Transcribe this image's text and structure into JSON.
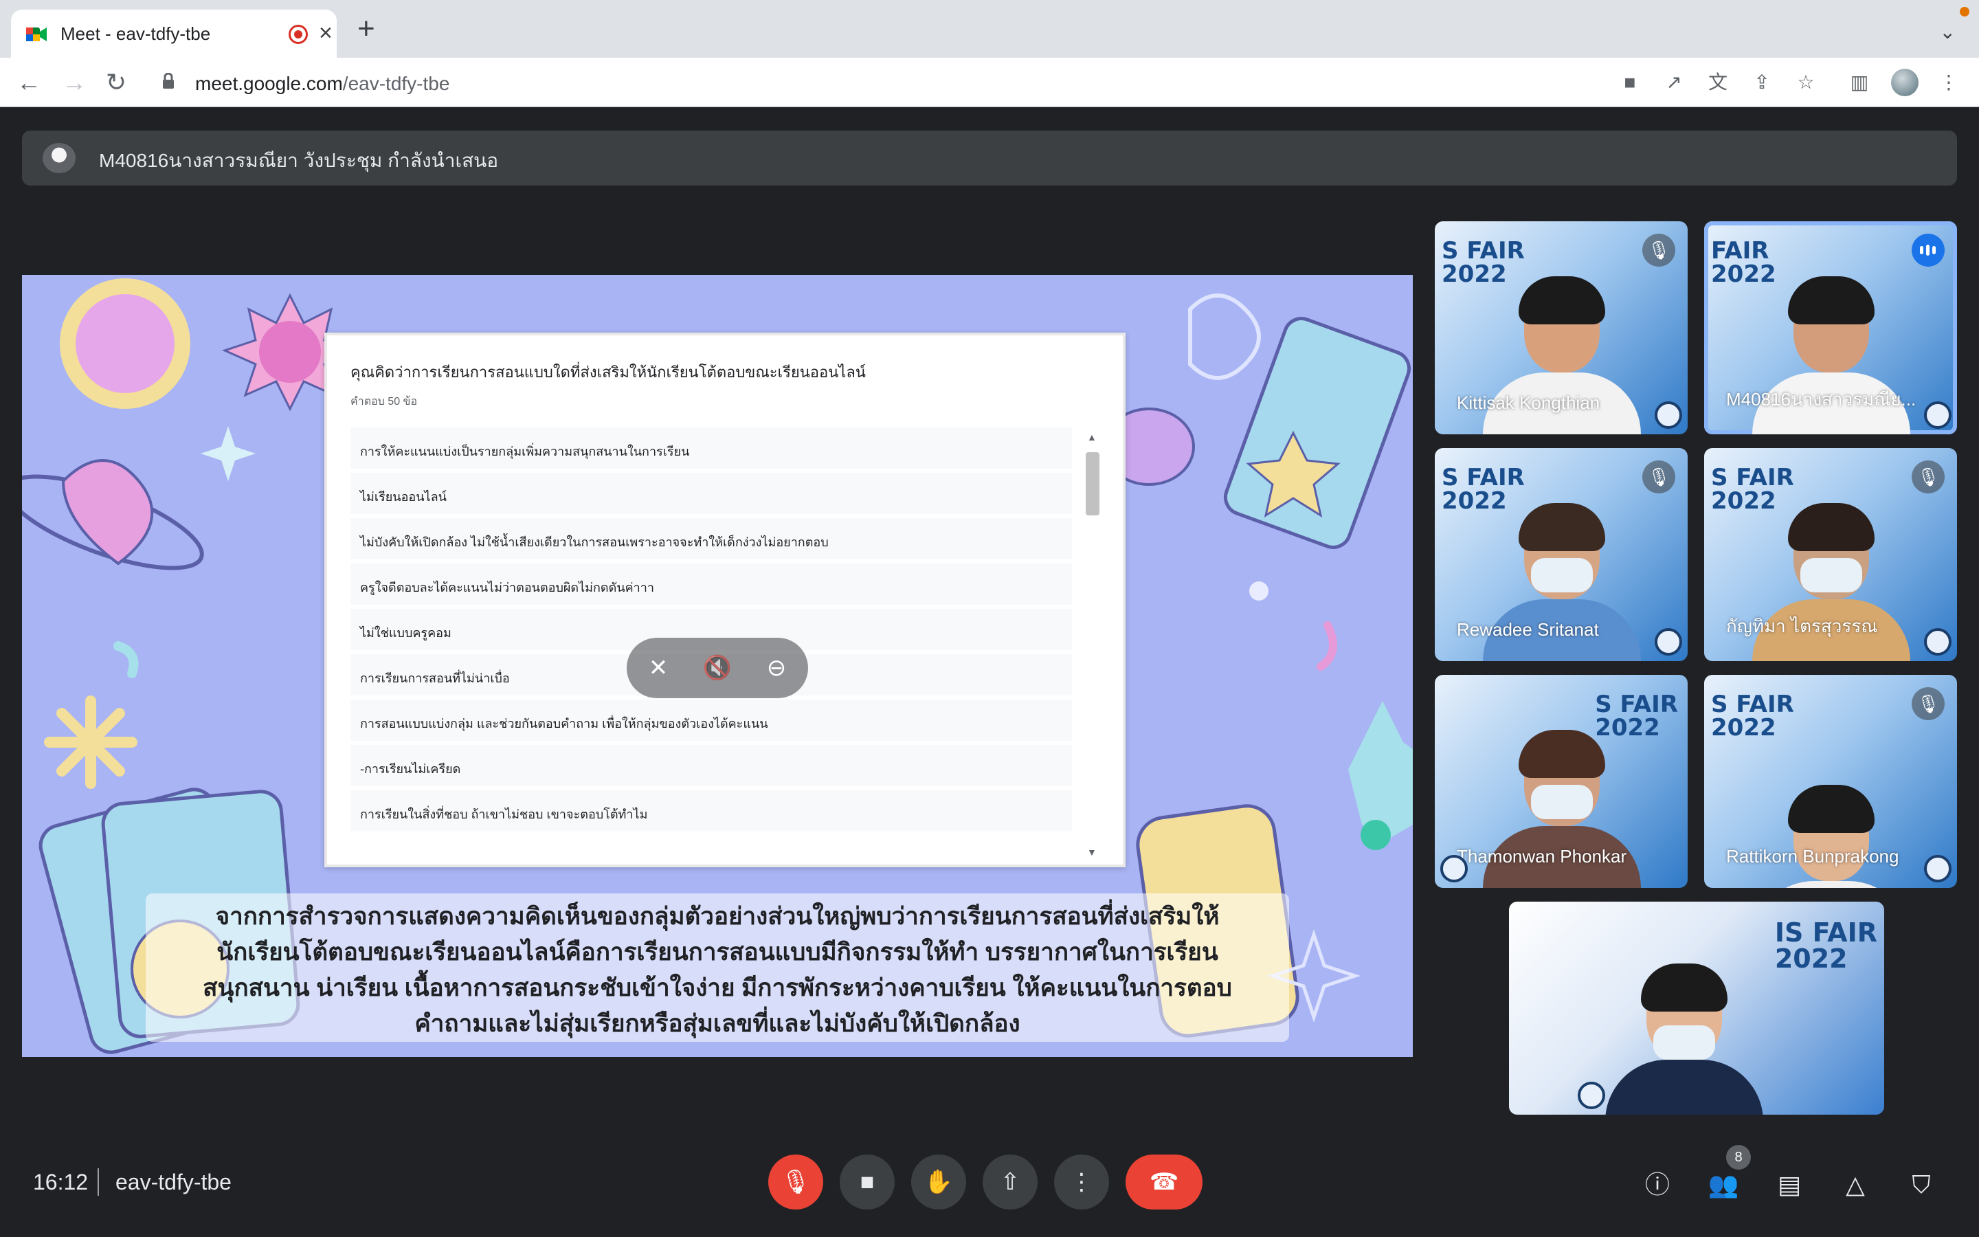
{
  "browser": {
    "tab_title": "Meet - eav-tdfy-tbe",
    "url_host": "meet.google.com",
    "url_path": "/eav-tdfy-tbe"
  },
  "presenter_bar": {
    "text": "M40816นางสาวรมณียา วังประชุม กำลังนำเสนอ"
  },
  "form": {
    "question": "คุณคิดว่าการเรียนการสอนแบบใดที่ส่งเสริมให้นักเรียนโต้ตอบขณะเรียนออนไลน์",
    "response_count": "คำตอบ 50 ข้อ",
    "answers": [
      "การให้คะแนนแบ่งเป็นรายกลุ่มเพิ่มความสนุกสนานในการเรียน",
      "ไม่เรียนออนไลน์",
      "ไม่บังคับให้เปิดกล้อง ไม่ใช้น้ำเสียงเดียวในการสอนเพราะอาจจะทำให้เด็กง่วงไม่อยากตอบ",
      "ครูใจดีตอบละได้คะแนนไม่ว่าตอนตอบผิดไม่กดดันค่าาา",
      "ไม่ใช่แบบครูคอม",
      "การเรียนการสอนที่ไม่น่าเบื่อ",
      "การสอนแบบแบ่งกลุ่ม และช่วยกันตอบคำถาม เพื่อให้กลุ่มของตัวเองได้คะแนน",
      "-การเรียนไม่เครียด",
      "การเรียนในสิ่งที่ชอบ ถ้าเขาไม่ชอบ เขาจะตอบโต้ทำไม"
    ]
  },
  "caption": {
    "lines": [
      "จากการสำรวจการแสดงความคิดเห็นของกลุ่มตัวอย่างส่วนใหญ่พบว่าการเรียนการสอนที่ส่งเสริมให้",
      "นักเรียนโต้ตอบขณะเรียนออนไลน์คือการเรียนการสอนแบบมีกิจกรรมให้ทำ บรรยากาศในการเรียน",
      "สนุกสนาน น่าเรียน เนื้อหาการสอนกระชับเข้าใจง่าย มีการพักระหว่างคาบเรียน ให้คะแนนในการตอบ",
      "คำถามและไม่สุ่มเรียกหรือสุ่มเลขที่และไม่บังคับให้เปิดกล้อง"
    ]
  },
  "participants": [
    {
      "name": "Kittisak Kongthian",
      "state": "muted",
      "fair": "S FAIR\n2022"
    },
    {
      "name": "M40816นางสาวรมณีย...",
      "state": "speaking",
      "fair": "FAIR\n2022"
    },
    {
      "name": "Rewadee Sritanat",
      "state": "muted",
      "fair": "S FAIR\n2022"
    },
    {
      "name": "กัญทิมา ไตรสุวรรณ",
      "state": "muted",
      "fair": "S FAIR\n2022"
    },
    {
      "name": "Thamonwan Phonkar",
      "state": "muted",
      "fair": "S FAIR\n2022"
    },
    {
      "name": "Rattikorn Bunprakong",
      "state": "muted",
      "fair": "S FAIR\n2022"
    },
    {
      "name": "",
      "state": "self",
      "fair": "IS FAIR\n2022"
    }
  ],
  "bottom": {
    "time": "16:12",
    "meeting_code": "eav-tdfy-tbe",
    "people_count": "8"
  },
  "icons": {
    "mic_off": "mic-off-icon",
    "camera": "camera-icon",
    "raise_hand": "raise-hand-icon",
    "present": "present-icon",
    "more": "more-options-icon",
    "end_call": "end-call-icon",
    "info": "info-icon",
    "people": "people-icon",
    "chat": "chat-icon",
    "activities": "activities-icon",
    "host_controls": "host-controls-icon"
  },
  "colors": {
    "meet_bg": "#202124",
    "end_call": "#ea4335",
    "speaking": "#1a73e8",
    "slide_bg": "#a9b4f4"
  }
}
